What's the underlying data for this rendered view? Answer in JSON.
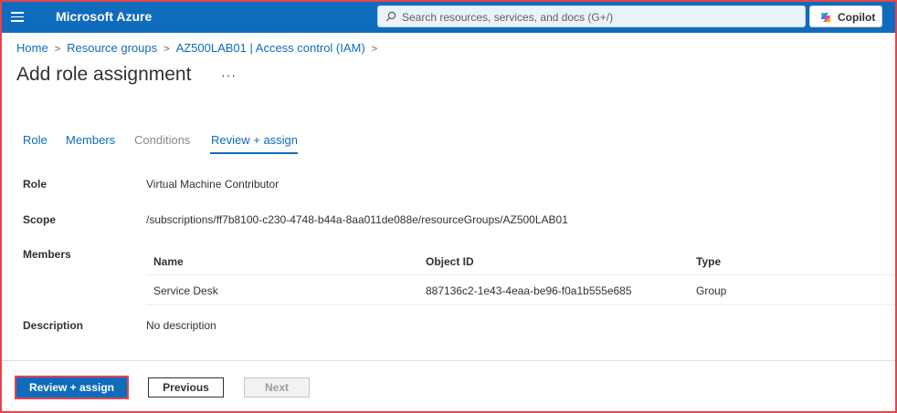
{
  "topbar": {
    "brand": "Microsoft Azure",
    "search_placeholder": "Search resources, services, and docs (G+/)",
    "copilot_label": "Copilot",
    "menu_icon": "hamburger-icon",
    "search_icon": "search-icon",
    "copilot_icon": "copilot-icon",
    "accent": "#0f6cbd"
  },
  "breadcrumb": {
    "items": [
      "Home",
      "Resource groups",
      "AZ500LAB01 | Access control (IAM)"
    ],
    "separator": ">"
  },
  "page": {
    "title": "Add role assignment",
    "more": "···"
  },
  "tabs": [
    {
      "label": "Role",
      "state": "link"
    },
    {
      "label": "Members",
      "state": "link"
    },
    {
      "label": "Conditions",
      "state": "disabled"
    },
    {
      "label": "Review + assign",
      "state": "active"
    }
  ],
  "details": {
    "role_label": "Role",
    "role_value": "Virtual Machine Contributor",
    "scope_label": "Scope",
    "scope_value": "/subscriptions/ff7b8100-c230-4748-b44a-8aa011de088e/resourceGroups/AZ500LAB01",
    "members_label": "Members",
    "description_label": "Description",
    "description_value": "No description"
  },
  "members_table": {
    "headers": [
      "Name",
      "Object ID",
      "Type"
    ],
    "rows": [
      [
        "Service Desk",
        "887136c2-1e43-4eaa-be96-f0a1b555e685",
        "Group"
      ]
    ]
  },
  "footer": {
    "primary_label": "Review + assign",
    "previous_label": "Previous",
    "next_label": "Next"
  }
}
